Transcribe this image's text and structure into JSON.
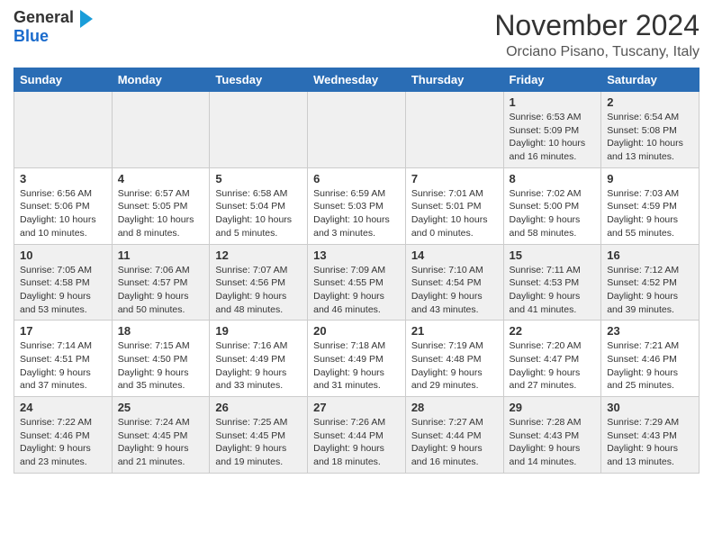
{
  "header": {
    "logo_text_general": "General",
    "logo_text_blue": "Blue",
    "month_title": "November 2024",
    "location": "Orciano Pisano, Tuscany, Italy"
  },
  "days_of_week": [
    "Sunday",
    "Monday",
    "Tuesday",
    "Wednesday",
    "Thursday",
    "Friday",
    "Saturday"
  ],
  "weeks": [
    {
      "cells": [
        {
          "day": "",
          "content": ""
        },
        {
          "day": "",
          "content": ""
        },
        {
          "day": "",
          "content": ""
        },
        {
          "day": "",
          "content": ""
        },
        {
          "day": "",
          "content": ""
        },
        {
          "day": "1",
          "content": "Sunrise: 6:53 AM\nSunset: 5:09 PM\nDaylight: 10 hours and 16 minutes."
        },
        {
          "day": "2",
          "content": "Sunrise: 6:54 AM\nSunset: 5:08 PM\nDaylight: 10 hours and 13 minutes."
        }
      ]
    },
    {
      "cells": [
        {
          "day": "3",
          "content": "Sunrise: 6:56 AM\nSunset: 5:06 PM\nDaylight: 10 hours and 10 minutes."
        },
        {
          "day": "4",
          "content": "Sunrise: 6:57 AM\nSunset: 5:05 PM\nDaylight: 10 hours and 8 minutes."
        },
        {
          "day": "5",
          "content": "Sunrise: 6:58 AM\nSunset: 5:04 PM\nDaylight: 10 hours and 5 minutes."
        },
        {
          "day": "6",
          "content": "Sunrise: 6:59 AM\nSunset: 5:03 PM\nDaylight: 10 hours and 3 minutes."
        },
        {
          "day": "7",
          "content": "Sunrise: 7:01 AM\nSunset: 5:01 PM\nDaylight: 10 hours and 0 minutes."
        },
        {
          "day": "8",
          "content": "Sunrise: 7:02 AM\nSunset: 5:00 PM\nDaylight: 9 hours and 58 minutes."
        },
        {
          "day": "9",
          "content": "Sunrise: 7:03 AM\nSunset: 4:59 PM\nDaylight: 9 hours and 55 minutes."
        }
      ]
    },
    {
      "cells": [
        {
          "day": "10",
          "content": "Sunrise: 7:05 AM\nSunset: 4:58 PM\nDaylight: 9 hours and 53 minutes."
        },
        {
          "day": "11",
          "content": "Sunrise: 7:06 AM\nSunset: 4:57 PM\nDaylight: 9 hours and 50 minutes."
        },
        {
          "day": "12",
          "content": "Sunrise: 7:07 AM\nSunset: 4:56 PM\nDaylight: 9 hours and 48 minutes."
        },
        {
          "day": "13",
          "content": "Sunrise: 7:09 AM\nSunset: 4:55 PM\nDaylight: 9 hours and 46 minutes."
        },
        {
          "day": "14",
          "content": "Sunrise: 7:10 AM\nSunset: 4:54 PM\nDaylight: 9 hours and 43 minutes."
        },
        {
          "day": "15",
          "content": "Sunrise: 7:11 AM\nSunset: 4:53 PM\nDaylight: 9 hours and 41 minutes."
        },
        {
          "day": "16",
          "content": "Sunrise: 7:12 AM\nSunset: 4:52 PM\nDaylight: 9 hours and 39 minutes."
        }
      ]
    },
    {
      "cells": [
        {
          "day": "17",
          "content": "Sunrise: 7:14 AM\nSunset: 4:51 PM\nDaylight: 9 hours and 37 minutes."
        },
        {
          "day": "18",
          "content": "Sunrise: 7:15 AM\nSunset: 4:50 PM\nDaylight: 9 hours and 35 minutes."
        },
        {
          "day": "19",
          "content": "Sunrise: 7:16 AM\nSunset: 4:49 PM\nDaylight: 9 hours and 33 minutes."
        },
        {
          "day": "20",
          "content": "Sunrise: 7:18 AM\nSunset: 4:49 PM\nDaylight: 9 hours and 31 minutes."
        },
        {
          "day": "21",
          "content": "Sunrise: 7:19 AM\nSunset: 4:48 PM\nDaylight: 9 hours and 29 minutes."
        },
        {
          "day": "22",
          "content": "Sunrise: 7:20 AM\nSunset: 4:47 PM\nDaylight: 9 hours and 27 minutes."
        },
        {
          "day": "23",
          "content": "Sunrise: 7:21 AM\nSunset: 4:46 PM\nDaylight: 9 hours and 25 minutes."
        }
      ]
    },
    {
      "cells": [
        {
          "day": "24",
          "content": "Sunrise: 7:22 AM\nSunset: 4:46 PM\nDaylight: 9 hours and 23 minutes."
        },
        {
          "day": "25",
          "content": "Sunrise: 7:24 AM\nSunset: 4:45 PM\nDaylight: 9 hours and 21 minutes."
        },
        {
          "day": "26",
          "content": "Sunrise: 7:25 AM\nSunset: 4:45 PM\nDaylight: 9 hours and 19 minutes."
        },
        {
          "day": "27",
          "content": "Sunrise: 7:26 AM\nSunset: 4:44 PM\nDaylight: 9 hours and 18 minutes."
        },
        {
          "day": "28",
          "content": "Sunrise: 7:27 AM\nSunset: 4:44 PM\nDaylight: 9 hours and 16 minutes."
        },
        {
          "day": "29",
          "content": "Sunrise: 7:28 AM\nSunset: 4:43 PM\nDaylight: 9 hours and 14 minutes."
        },
        {
          "day": "30",
          "content": "Sunrise: 7:29 AM\nSunset: 4:43 PM\nDaylight: 9 hours and 13 minutes."
        }
      ]
    }
  ]
}
